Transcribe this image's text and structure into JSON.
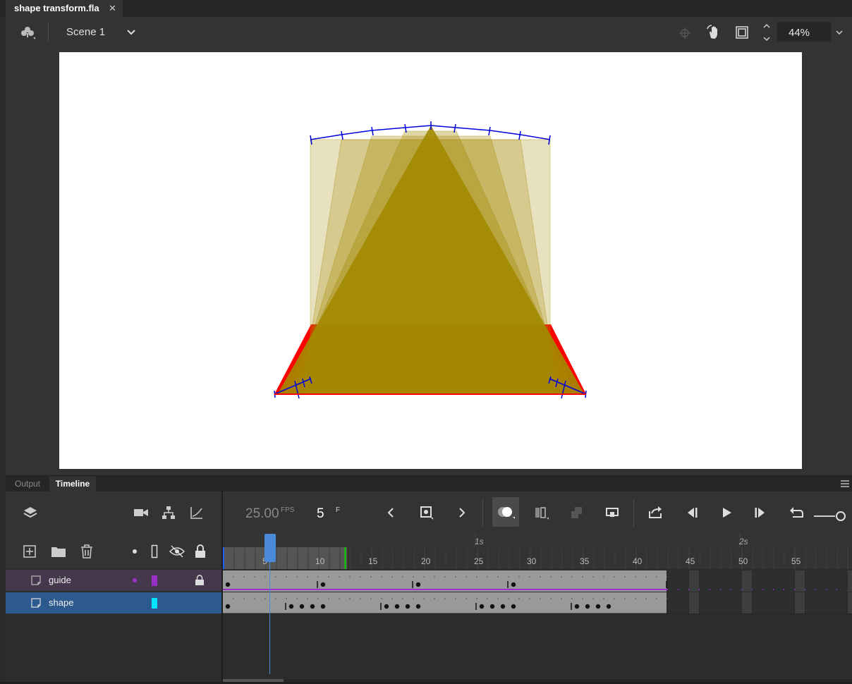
{
  "doc_tab": {
    "title": "shape transform.fla",
    "close": "✕"
  },
  "edit_bar": {
    "scene_label": "Scene 1",
    "zoom_value": "44%"
  },
  "panel_tabs": {
    "output": "Output",
    "timeline": "Timeline"
  },
  "timeline": {
    "fps_value": "25.00",
    "fps_unit": "FPS",
    "current_frame": "5",
    "frame_unit": "F",
    "ruler_labels": [
      "5",
      "10",
      "15",
      "20",
      "25",
      "30",
      "35",
      "40",
      "45",
      "50",
      "55"
    ],
    "time_markers": [
      "1s",
      "2s"
    ],
    "playhead_frame": 5,
    "layers": [
      {
        "name": "guide",
        "color": "#9b30c8",
        "locked": true,
        "selected": false
      },
      {
        "name": "shape",
        "color": "#00e5ff",
        "locked": false,
        "selected": true
      }
    ]
  },
  "colors": {
    "accent_blue": "#2d5a8e",
    "guide_purple": "#9b30c8",
    "shape_cyan": "#00e5ff",
    "onion_tint": "#a38900",
    "shape_red": "#ff0000",
    "guide_line": "#0000dd"
  }
}
